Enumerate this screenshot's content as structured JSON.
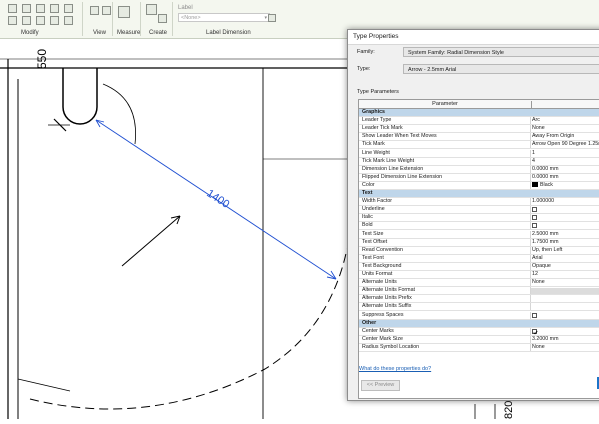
{
  "ribbon": {
    "groups": [
      {
        "name": "modify",
        "label": "Modify"
      },
      {
        "name": "view",
        "label": "View"
      },
      {
        "name": "measure",
        "label": "Measure"
      },
      {
        "name": "create",
        "label": "Create"
      },
      {
        "name": "label-dimension",
        "label": "Label Dimension"
      }
    ],
    "label_field": {
      "title": "Label",
      "value": "<None>"
    }
  },
  "drawing": {
    "dimension_text": "1400",
    "dim_550": "550",
    "dim_820": "820"
  },
  "dialog": {
    "title": "Type Properties",
    "family_label": "Family:",
    "family_value": "System Family: Radial Dimension Style",
    "type_label": "Type:",
    "type_value": "Arrow - 2.5mm Arial",
    "type_parameters_label": "Type Parameters",
    "grid_header": "Parameter",
    "rows": [
      {
        "kind": "cat",
        "k": "Graphics"
      },
      {
        "k": "Leader Type",
        "v": "Arc"
      },
      {
        "k": "Leader Tick Mark",
        "v": "None"
      },
      {
        "k": "Show Leader When Text Moves",
        "v": "Away From Origin"
      },
      {
        "k": "Tick Mark",
        "v": "Arrow Open 90 Degree 1.25mm"
      },
      {
        "k": "Line Weight",
        "v": "1"
      },
      {
        "k": "Tick Mark Line Weight",
        "v": "4"
      },
      {
        "k": "Dimension Line Extension",
        "v": "0.0000 mm"
      },
      {
        "k": "Flipped Dimension Line Extension",
        "v": "0.0000 mm"
      },
      {
        "k": "Color",
        "v": "Black",
        "swatch": true
      },
      {
        "kind": "cat",
        "k": "Text"
      },
      {
        "k": "Width Factor",
        "v": "1.000000"
      },
      {
        "k": "Underline",
        "check": false
      },
      {
        "k": "Italic",
        "check": false
      },
      {
        "k": "Bold",
        "check": false
      },
      {
        "k": "Text Size",
        "v": "2.5000 mm"
      },
      {
        "k": "Text Offset",
        "v": "1.7500 mm"
      },
      {
        "k": "Read Convention",
        "v": "Up, then Left"
      },
      {
        "k": "Text Font",
        "v": "Arial"
      },
      {
        "k": "Text Background",
        "v": "Opaque"
      },
      {
        "k": "Units Format",
        "v": "12"
      },
      {
        "k": "Alternate Units",
        "v": "None"
      },
      {
        "k": "Alternate Units Format",
        "gray": true
      },
      {
        "k": "Alternate Units Prefix"
      },
      {
        "k": "Alternate Units Suffix"
      },
      {
        "k": "Suppress Spaces",
        "check": false
      },
      {
        "kind": "cat",
        "k": "Other"
      },
      {
        "k": "Center Marks",
        "check": true
      },
      {
        "k": "Center Mark Size",
        "v": "3.2000 mm"
      },
      {
        "k": "Radius Symbol Location",
        "v": "None"
      }
    ],
    "help_link": "What do these properties do?",
    "preview_button": "<< Preview"
  },
  "colors": {
    "dimension": "#1f4fd1",
    "category_bg": "#bfd6ea"
  }
}
